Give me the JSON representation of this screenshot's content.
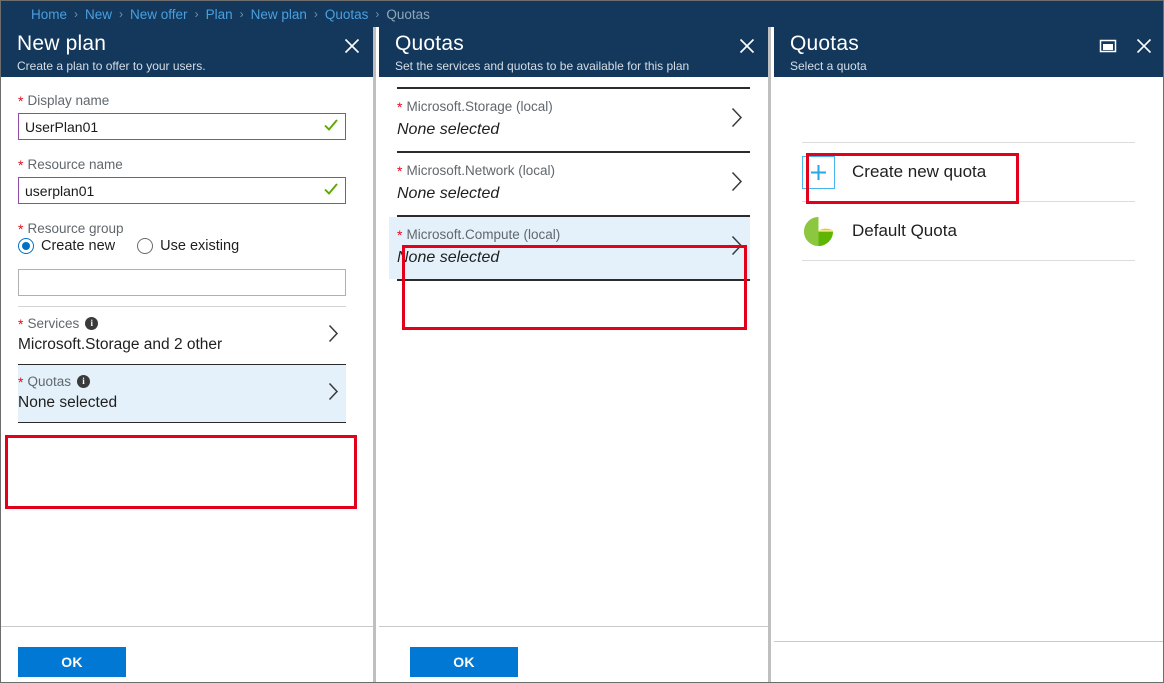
{
  "breadcrumb": {
    "items": [
      {
        "label": "Home",
        "current": false
      },
      {
        "label": "New",
        "current": false
      },
      {
        "label": "New offer",
        "current": false
      },
      {
        "label": "Plan",
        "current": false
      },
      {
        "label": "New plan",
        "current": false
      },
      {
        "label": "Quotas",
        "current": false
      },
      {
        "label": "Quotas",
        "current": true
      }
    ],
    "separator": "›"
  },
  "colors": {
    "header_blue": "#13385c",
    "accent_blue": "#0078d4",
    "link_blue": "#4a9fe0",
    "annotation_red": "#e3001b",
    "highlight_bg": "#e4f1fa",
    "required_star": "#e00b1c",
    "input_border_validated": "#8e4ca8",
    "check_green": "#5ca800",
    "plus_blue": "#2aa5e8"
  },
  "new_plan_blade": {
    "title": "New plan",
    "subtitle": "Create a plan to offer to your users.",
    "close_icon": "close-icon",
    "display_name": {
      "label": "Display name",
      "value": "UserPlan01",
      "placeholder": "",
      "required_marker": "*",
      "valid_icon": "checkmark-icon"
    },
    "resource_name": {
      "label": "Resource name",
      "value": "userplan01",
      "placeholder": "",
      "required_marker": "*",
      "valid_icon": "checkmark-icon"
    },
    "resource_group": {
      "label": "Resource group",
      "required_marker": "*",
      "options": [
        {
          "label": "Create new",
          "selected": true
        },
        {
          "label": "Use existing",
          "selected": false
        }
      ],
      "value": "",
      "placeholder": ""
    },
    "services": {
      "label": "Services",
      "required_marker": "*",
      "info_icon": "info-icon",
      "value": "Microsoft.Storage and 2 other",
      "chevron_icon": "chevron-right-icon",
      "highlighted": false
    },
    "quotas": {
      "label": "Quotas",
      "required_marker": "*",
      "info_icon": "info-icon",
      "value": "None selected",
      "chevron_icon": "chevron-right-icon",
      "highlighted": true
    },
    "ok_button": "OK"
  },
  "quotas_mid_blade": {
    "title": "Quotas",
    "subtitle": "Set the services and quotas to be available for this plan",
    "close_icon": "close-icon",
    "rows": [
      {
        "label": "Microsoft.Storage (local)",
        "required_marker": "*",
        "value": "None selected",
        "chevron_icon": "chevron-right-icon",
        "highlighted": false
      },
      {
        "label": "Microsoft.Network (local)",
        "required_marker": "*",
        "value": "None selected",
        "chevron_icon": "chevron-right-icon",
        "highlighted": false
      },
      {
        "label": "Microsoft.Compute (local)",
        "required_marker": "*",
        "value": "None selected",
        "chevron_icon": "chevron-right-icon",
        "highlighted": true
      }
    ],
    "ok_button": "OK"
  },
  "quotas_right_blade": {
    "title": "Quotas",
    "subtitle": "Select a quota",
    "maximize_icon": "maximize-icon",
    "close_icon": "close-icon",
    "create_new": {
      "label": "Create new quota",
      "icon": "plus-icon",
      "highlighted": true
    },
    "items": [
      {
        "label": "Default Quota",
        "icon": "quota-pie-icon"
      }
    ]
  }
}
